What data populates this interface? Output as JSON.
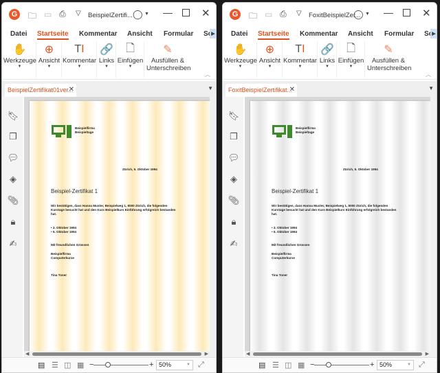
{
  "windows": [
    {
      "title": "BeispielZertifi...",
      "doc_tab": "BeispielZertifikat01ver...",
      "theme": "y"
    },
    {
      "title": "FoxitBeispielZer...",
      "doc_tab": "FoxitBeispielZertifikat...",
      "theme": "g"
    }
  ],
  "menu_tabs": [
    "Datei",
    "Startseite",
    "Kommentar",
    "Ansicht",
    "Formular",
    "Sch"
  ],
  "ribbon": [
    "Werkzeuge",
    "Ansicht",
    "Kommentar",
    "Links",
    "Einfügen",
    "Ausfüllen &",
    "Unterschreiben"
  ],
  "doc": {
    "company1": "Beispielfirma",
    "company2": "Beispieltage",
    "date": "Zürich, 5. Oktober 1994",
    "title": "Beispiel-Zertifikat 1",
    "body1": "Wir bestätigen, dass Hanna Muster, Beispielweg 1, 8000 Zürich, die folgenden",
    "body2": "Kurstage besucht hat und den Kurs Beispielkurs Einführung erfolgreich bestanden",
    "body3": "hat.",
    "bullet1": "• 3. Oktober 1994",
    "bullet2": "• 5. Oktober 1994",
    "greeting": "Mit freundlichen Grüssen",
    "sign1": "Beispielfirma",
    "sign2": "Computerkurse",
    "name": "Tina Toner"
  },
  "zoom": "50%",
  "colors": {
    "accent": "#d9531e",
    "logo": "#3f8a2c"
  }
}
